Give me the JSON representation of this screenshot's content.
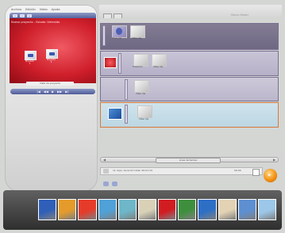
{
  "menu": [
    "Archivo",
    "Edición",
    "Vídeo",
    "Ayuda"
  ],
  "left_panel": {
    "toolbar_buttons": [
      "«",
      "»",
      "+"
    ],
    "preview_title": "Nuevo proyecto - Estado: Detenido",
    "desktop_icons": [
      {
        "label": "Proyecto 1"
      },
      {
        "label": "Proyecto 2"
      }
    ],
    "preview_footer": "Vista de proyecto",
    "playback": [
      "|◀",
      "◀◀",
      "▶",
      "▶▶",
      "▶|"
    ]
  },
  "brand": "Movie Maker",
  "tabs": [
    "",
    ""
  ],
  "storyboard": {
    "rows": [
      {
        "tab_label": "",
        "clips": [
          {
            "caption": "Título clip"
          },
          {
            "caption": "Vídeo clip"
          }
        ]
      },
      {
        "tab_label": "",
        "clips": [
          {
            "caption": "Transición"
          },
          {
            "caption": "Vídeo clip"
          }
        ]
      },
      {
        "tab_label": "",
        "clips": [
          {
            "caption": "Vídeo clip"
          }
        ]
      },
      {
        "tab_label": "",
        "clips": [
          {
            "caption": "Vídeo clip"
          }
        ]
      }
    ]
  },
  "scrollbar": {
    "label": "Línea de tiempo"
  },
  "info": {
    "text": "11 clips, duración total: 00:01:34",
    "time": "00:00"
  },
  "go_button": "►",
  "filmstrip_colors": [
    "#2f5fb9",
    "#e59b2b",
    "#e63b2a",
    "#4fa1d8",
    "#6db7c9",
    "#d8d1b8",
    "#d11c22",
    "#3e8f3d",
    "#2d6fc6",
    "#e3d2b4",
    "#5d8fd1",
    "#9cc7e9"
  ]
}
